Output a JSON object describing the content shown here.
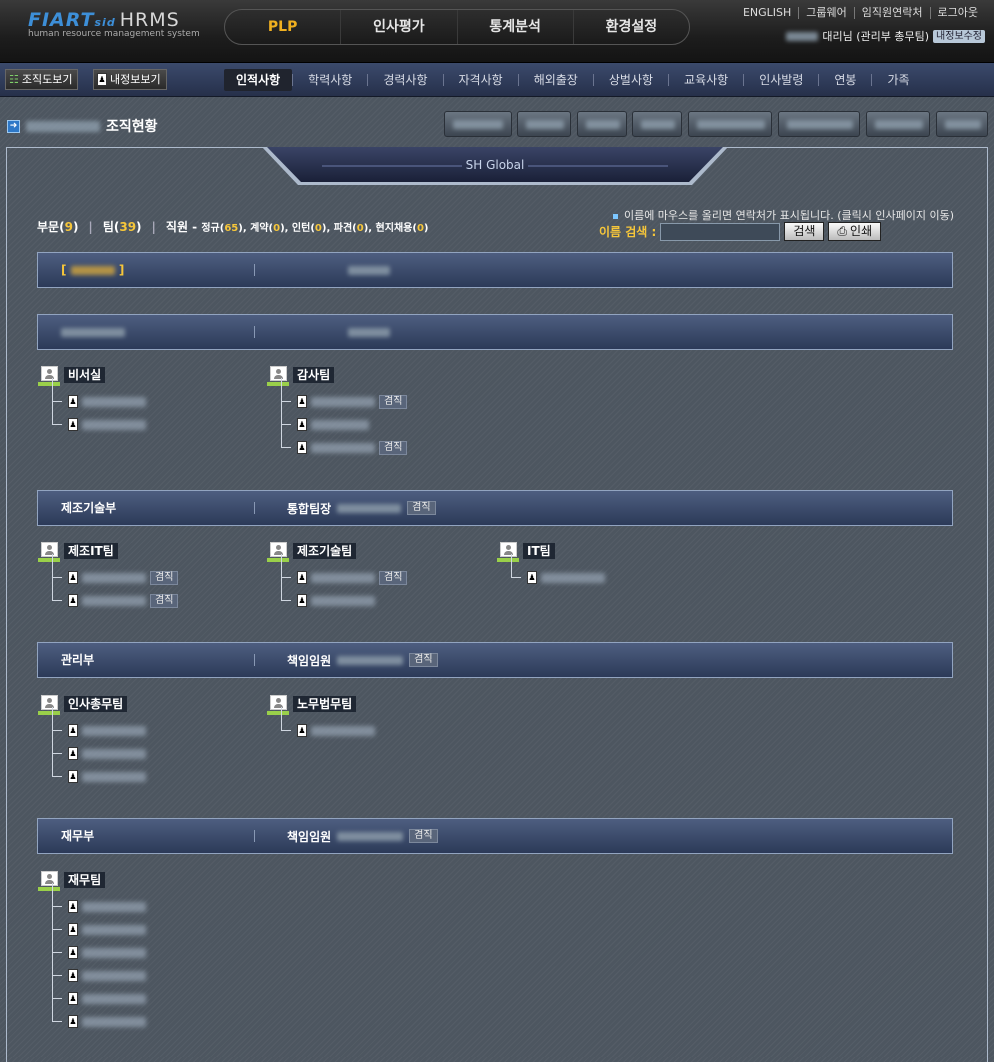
{
  "header": {
    "logo_main": "FIART",
    "logo_sub": "sid",
    "logo_product": "HRMS",
    "logo_tagline": "human resource management system",
    "main_nav": [
      {
        "label": "PLP",
        "active": true
      },
      {
        "label": "인사평가",
        "active": false
      },
      {
        "label": "통계분석",
        "active": false
      },
      {
        "label": "환경설정",
        "active": false
      }
    ],
    "top_links": [
      "ENGLISH",
      "그룹웨어",
      "임직원연락처",
      "로그아웃"
    ],
    "user_title": "대리님 (관리부 총무팀)",
    "user_edit_label": "내정보수정"
  },
  "subbar": {
    "org_view_label": "조직도보기",
    "myinfo_view_label": "내정보보기",
    "tabs": [
      {
        "label": "인적사항",
        "active": true
      },
      {
        "label": "학력사항",
        "active": false
      },
      {
        "label": "경력사항",
        "active": false
      },
      {
        "label": "자격사항",
        "active": false
      },
      {
        "label": "해외출장",
        "active": false
      },
      {
        "label": "상벌사항",
        "active": false
      },
      {
        "label": "교육사항",
        "active": false
      },
      {
        "label": "인사발령",
        "active": false
      },
      {
        "label": "연봉",
        "active": false
      },
      {
        "label": "가족",
        "active": false
      }
    ]
  },
  "page": {
    "title": "조직현황",
    "company_tab": "SH Global"
  },
  "summary": {
    "dept_label": "부문",
    "dept_count": "9",
    "team_label": "팀",
    "team_count": "39",
    "staff_label": "직원 -",
    "regular_label": "정규",
    "regular_count": "65",
    "contract_label": ", 계약",
    "contract_count": "0",
    "intern_label": ", 인턴",
    "intern_count": "0",
    "dispatch_label": ", 파견",
    "dispatch_count": "0",
    "local_label": ", 현지채용",
    "local_count": "0"
  },
  "hint": "이름에 마우스를 올리면 연락처가 표시됩니다. (클릭시 인사페이지 이동)",
  "search": {
    "label": "이름 검색 :",
    "value": "",
    "search_button": "검색",
    "print_button": "인쇄"
  },
  "departments": [
    {
      "name": "[ ]",
      "head_label": "",
      "concurrent": ""
    },
    {
      "name": "",
      "head_label": "",
      "concurrent": ""
    },
    {
      "name": "제조기술부",
      "head_label": "통합팀장",
      "concurrent": "겸직"
    },
    {
      "name": "관리부",
      "head_label": "책임임원",
      "concurrent": "겸직"
    },
    {
      "name": "재무부",
      "head_label": "책임임원",
      "concurrent": "겸직"
    }
  ],
  "teams": [
    {
      "name": "비서실",
      "members": [
        {
          "concurrent": ""
        },
        {
          "concurrent": ""
        }
      ]
    },
    {
      "name": "감사팀",
      "members": [
        {
          "concurrent": "겸직"
        },
        {
          "concurrent": ""
        },
        {
          "concurrent": "겸직"
        }
      ]
    },
    {
      "name": "제조IT팀",
      "members": [
        {
          "concurrent": "겸직"
        },
        {
          "concurrent": "겸직"
        }
      ]
    },
    {
      "name": "제조기술팀",
      "members": [
        {
          "concurrent": "겸직"
        },
        {
          "concurrent": ""
        }
      ]
    },
    {
      "name": "IT팀",
      "members": [
        {
          "concurrent": ""
        }
      ]
    },
    {
      "name": "인사총무팀",
      "members": [
        {
          "concurrent": ""
        },
        {
          "concurrent": ""
        },
        {
          "concurrent": ""
        }
      ]
    },
    {
      "name": "노무법무팀",
      "members": [
        {
          "concurrent": ""
        }
      ]
    },
    {
      "name": "재무팀",
      "members": [
        {
          "concurrent": ""
        },
        {
          "concurrent": ""
        },
        {
          "concurrent": ""
        },
        {
          "concurrent": ""
        },
        {
          "concurrent": ""
        },
        {
          "concurrent": ""
        }
      ]
    }
  ]
}
